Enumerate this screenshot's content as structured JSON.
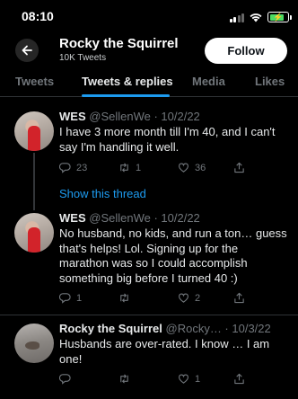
{
  "status_bar": {
    "time": "08:10"
  },
  "header": {
    "profile_name": "Rocky the Squirrel",
    "tweet_count": "10K Tweets",
    "follow_label": "Follow"
  },
  "tabs": [
    {
      "label": "Tweets"
    },
    {
      "label": "Tweets & replies"
    },
    {
      "label": "Media"
    },
    {
      "label": "Likes"
    }
  ],
  "active_tab": "Tweets & replies",
  "show_thread_label": "Show this thread",
  "tweets": [
    {
      "author": "WES",
      "handle_date": "@SellenWe · 10/2/22",
      "text": "I have 3 more month till I'm 40, and I can't say I'm handling it well.",
      "replies": "23",
      "retweets": "1",
      "likes": "36"
    },
    {
      "author": "WES",
      "handle_date": "@SellenWe · 10/2/22",
      "text": "No husband, no kids, and run a ton… guess that's helps! Lol. Signing up for the marathon was so I could accomplish something big before I turned 40 :)",
      "replies": "1",
      "retweets": "",
      "likes": "2"
    },
    {
      "author": "Rocky the Squirrel",
      "handle_date": "@Rocky… · 10/3/22",
      "text": "Husbands are over-rated. I know … I am one!",
      "replies": "",
      "retweets": "",
      "likes": "1"
    }
  ],
  "colors": {
    "accent": "#1d9bf0",
    "background": "#000000",
    "muted": "#71767b"
  }
}
